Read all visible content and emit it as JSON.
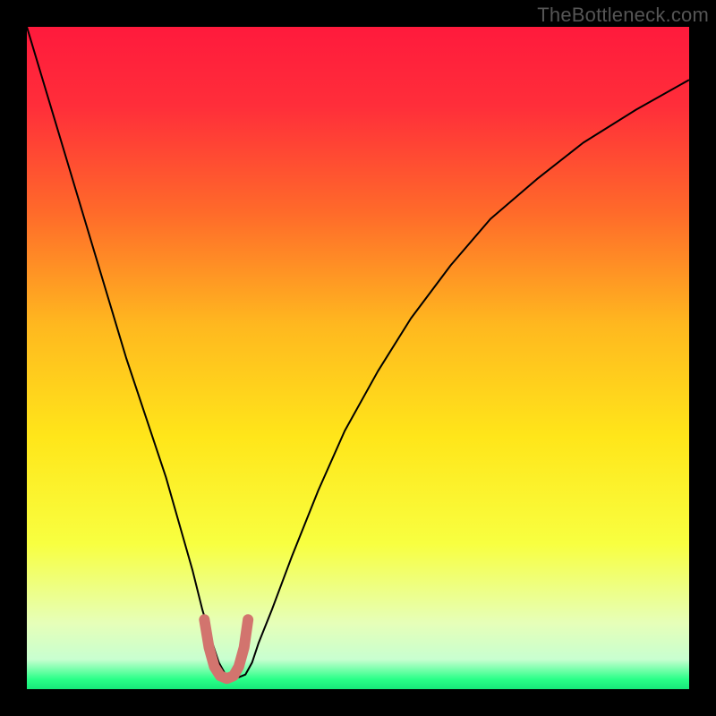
{
  "watermark": "TheBottleneck.com",
  "chart_data": {
    "type": "line",
    "title": "",
    "xlabel": "",
    "ylabel": "",
    "xlim": [
      0,
      100
    ],
    "ylim": [
      0,
      100
    ],
    "gradient_stops": [
      {
        "offset": 0.0,
        "color": "#ff1a3c"
      },
      {
        "offset": 0.12,
        "color": "#ff2e3a"
      },
      {
        "offset": 0.28,
        "color": "#ff6a2a"
      },
      {
        "offset": 0.45,
        "color": "#ffb81f"
      },
      {
        "offset": 0.62,
        "color": "#ffe61a"
      },
      {
        "offset": 0.78,
        "color": "#f8ff40"
      },
      {
        "offset": 0.9,
        "color": "#e6ffb8"
      },
      {
        "offset": 0.955,
        "color": "#c8ffd0"
      },
      {
        "offset": 0.985,
        "color": "#2aff88"
      },
      {
        "offset": 1.0,
        "color": "#17e879"
      }
    ],
    "series": [
      {
        "name": "bottleneck-curve",
        "color": "#000000",
        "width": 2,
        "x": [
          0,
          3,
          6,
          9,
          12,
          15,
          18,
          21,
          23,
          25,
          26.5,
          28,
          29,
          30,
          31,
          32,
          33,
          34,
          35,
          37,
          40,
          44,
          48,
          53,
          58,
          64,
          70,
          77,
          84,
          92,
          100
        ],
        "y": [
          100,
          90,
          80,
          70,
          60,
          50,
          41,
          32,
          25,
          18,
          12,
          7,
          4,
          2.2,
          1.8,
          1.8,
          2.2,
          4,
          7,
          12,
          20,
          30,
          39,
          48,
          56,
          64,
          71,
          77,
          82.5,
          87.5,
          92
        ]
      },
      {
        "name": "min-region-highlight",
        "color": "#d2746e",
        "width": 12,
        "linecap": "round",
        "x": [
          26.8,
          27.5,
          28.3,
          29.2,
          30.2,
          31.2,
          32.0,
          32.8,
          33.4
        ],
        "y": [
          10.5,
          6.3,
          3.4,
          2.0,
          1.6,
          2.0,
          3.4,
          6.3,
          10.5
        ]
      }
    ]
  }
}
